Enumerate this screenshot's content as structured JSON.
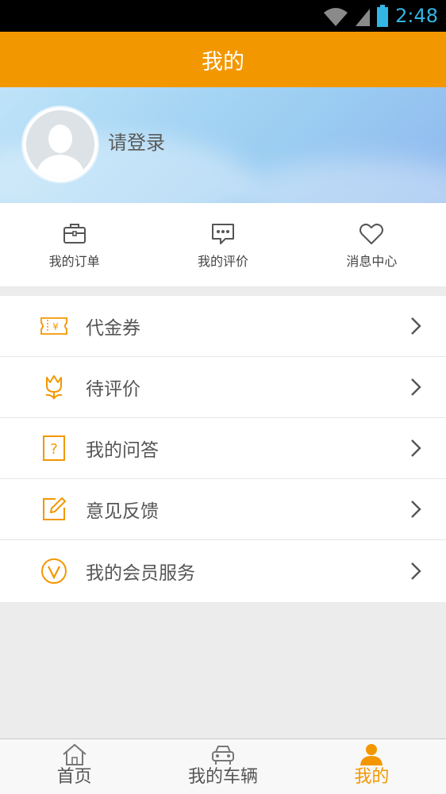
{
  "status_bar": {
    "time": "2:48"
  },
  "header": {
    "title": "我的"
  },
  "profile": {
    "login_text": "请登录"
  },
  "quick_actions": [
    {
      "label": "我的订单",
      "icon": "briefcase-icon"
    },
    {
      "label": "我的评价",
      "icon": "chat-bubble-icon"
    },
    {
      "label": "消息中心",
      "icon": "heart-icon"
    }
  ],
  "menu": [
    {
      "label": "代金券",
      "icon": "voucher-icon"
    },
    {
      "label": "待评价",
      "icon": "tulip-icon"
    },
    {
      "label": "我的问答",
      "icon": "question-icon"
    },
    {
      "label": "意见反馈",
      "icon": "edit-icon"
    },
    {
      "label": "我的会员服务",
      "icon": "vip-icon"
    }
  ],
  "bottom_nav": [
    {
      "label": "首页",
      "icon": "home-icon",
      "active": false
    },
    {
      "label": "我的车辆",
      "icon": "car-icon",
      "active": false
    },
    {
      "label": "我的",
      "icon": "user-icon",
      "active": true
    }
  ],
  "colors": {
    "accent": "#f39700",
    "status_time": "#33b5e5",
    "background": "#ececec"
  }
}
